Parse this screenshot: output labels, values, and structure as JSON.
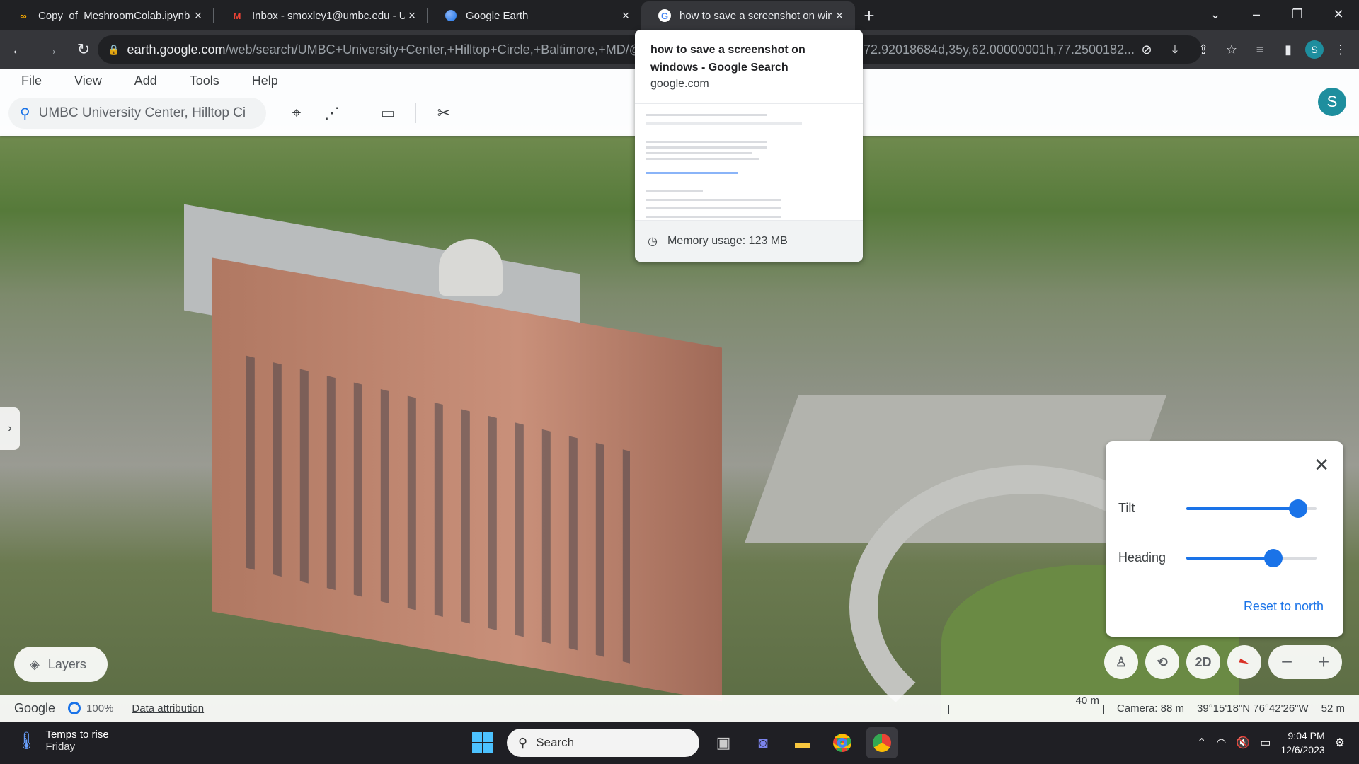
{
  "browser": {
    "tabs": [
      {
        "title": "Copy_of_MeshroomColab.ipynb",
        "icon": "colab-icon",
        "color": "#f9ab00"
      },
      {
        "title": "Inbox - smoxley1@umbc.edu - U",
        "icon": "gmail-icon",
        "color": "#ea4335"
      },
      {
        "title": "Google Earth",
        "icon": "earth-icon",
        "color": "#4285f4"
      },
      {
        "title": "how to save a screenshot on win",
        "icon": "google-icon",
        "color": "#4285f4"
      }
    ],
    "active_tab": 3,
    "url_host": "earth.google.com",
    "url_path": "/web/search/UMBC+University+Center,+Hilltop+Circle,+Baltimore,+MD/@",
    "url_tail": "72.92018684d,35y,62.00000001h,77.2500182...",
    "profile_initial": "S"
  },
  "hover_card": {
    "title": "how to save a screenshot on windows - Google Search",
    "domain": "google.com",
    "memory": "Memory usage: 123 MB"
  },
  "earth": {
    "menus": [
      "File",
      "View",
      "Add",
      "Tools",
      "Help"
    ],
    "search_value": "UMBC University Center, Hilltop Ci",
    "account_initial": "S",
    "layers_label": "Layers",
    "tilt_panel": {
      "tilt_label": "Tilt",
      "tilt_value": 0.86,
      "heading_label": "Heading",
      "heading_value": 0.67,
      "reset_label": "Reset to north"
    },
    "ctl_2d": "2D",
    "status": {
      "brand": "Google",
      "percent": "100%",
      "attribution": "Data attribution",
      "scale": "40 m",
      "camera": "Camera: 88 m",
      "coords": "39°15'18\"N 76°42'26\"W",
      "elevation": "52 m"
    }
  },
  "taskbar": {
    "weather_line1": "Temps to rise",
    "weather_line2": "Friday",
    "search_label": "Search",
    "time": "9:04 PM",
    "date": "12/6/2023"
  }
}
